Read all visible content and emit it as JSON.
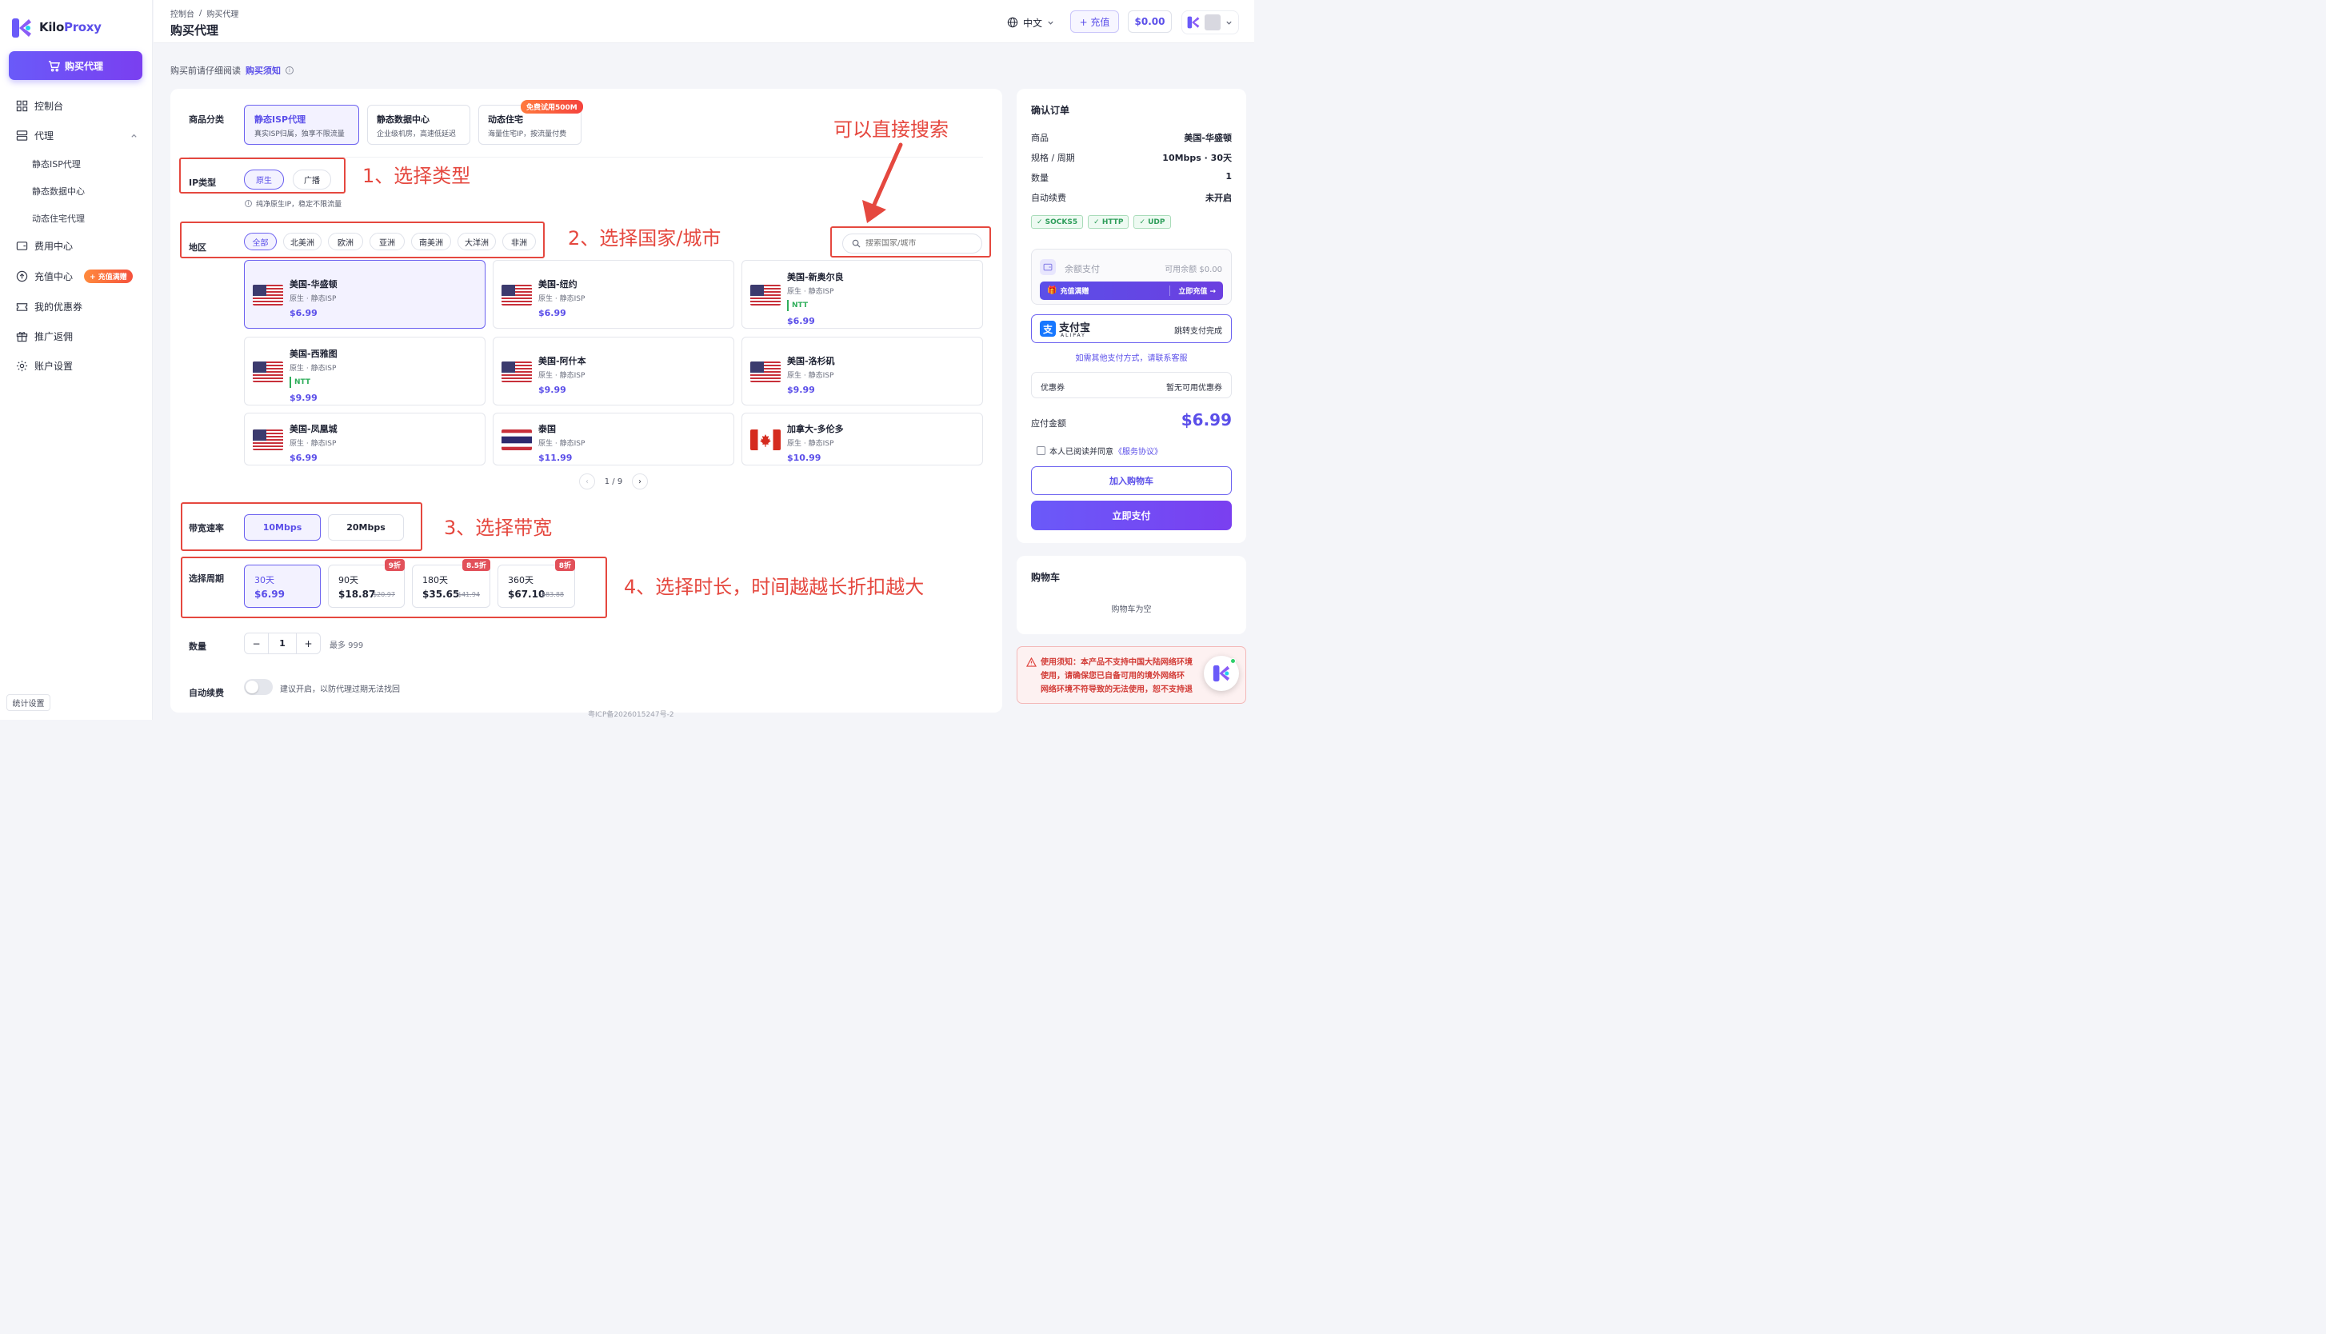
{
  "brand": {
    "name_a": "Kilo",
    "name_b": "Proxy"
  },
  "sidebar": {
    "buy_label": "购买代理",
    "items": [
      {
        "label": "控制台"
      },
      {
        "label": "代理"
      },
      {
        "label": "费用中心"
      },
      {
        "label": "充值中心",
        "badge": "+ 充值满赠"
      },
      {
        "label": "我的优惠券"
      },
      {
        "label": "推广返佣"
      },
      {
        "label": "账户设置"
      }
    ],
    "subitems": [
      {
        "label": "静态ISP代理"
      },
      {
        "label": "静态数据中心"
      },
      {
        "label": "动态住宅代理"
      }
    ],
    "stats_label": "统计设置"
  },
  "header": {
    "breadcrumb_root": "控制台",
    "breadcrumb_sep": "/",
    "breadcrumb_current": "购买代理",
    "title": "购买代理",
    "language": "中文",
    "recharge_label": "+ 充值",
    "balance": "$0.00"
  },
  "notice": {
    "text": "购买前请仔细阅读",
    "link": "购买须知"
  },
  "product": {
    "label": "商品分类",
    "options": [
      {
        "title": "静态ISP代理",
        "desc": "真实ISP归属，独享不限流量"
      },
      {
        "title": "静态数据中心",
        "desc": "企业级机房，高速低延迟"
      },
      {
        "title": "动态住宅",
        "desc": "海量住宅IP，按流量付费",
        "badge": "免费试用500M"
      }
    ]
  },
  "ip_type": {
    "label": "IP类型",
    "options": [
      "原生",
      "广播"
    ],
    "hint": "纯净原生IP，稳定不限流量"
  },
  "region": {
    "label": "地区",
    "filters": [
      "全部",
      "北美洲",
      "欧洲",
      "亚洲",
      "南美洲",
      "大洋洲",
      "非洲"
    ],
    "search_placeholder": "搜索国家/城市",
    "cards": [
      {
        "name": "美国-华盛顿",
        "sub": "原生 · 静态ISP",
        "price": "$6.99",
        "flag": "us"
      },
      {
        "name": "美国-纽约",
        "sub": "原生 · 静态ISP",
        "price": "$6.99",
        "flag": "us"
      },
      {
        "name": "美国-新奥尔良",
        "sub": "原生 · 静态ISP",
        "tag": "NTT",
        "price": "$6.99",
        "flag": "us"
      },
      {
        "name": "美国-西雅图",
        "sub": "原生 · 静态ISP",
        "tag": "NTT",
        "price": "$9.99",
        "flag": "us"
      },
      {
        "name": "美国-阿什本",
        "sub": "原生 · 静态ISP",
        "price": "$9.99",
        "flag": "us"
      },
      {
        "name": "美国-洛杉矶",
        "sub": "原生 · 静态ISP",
        "price": "$9.99",
        "flag": "us"
      },
      {
        "name": "美国-凤凰城",
        "sub": "原生 · 静态ISP",
        "price": "$6.99",
        "flag": "us"
      },
      {
        "name": "泰国",
        "sub": "原生 · 静态ISP",
        "price": "$11.99",
        "flag": "th"
      },
      {
        "name": "加拿大-多伦多",
        "sub": "原生 · 静态ISP",
        "price": "$10.99",
        "flag": "ca"
      }
    ],
    "page": "1 / 9"
  },
  "bandwidth": {
    "label": "带宽速率",
    "options": [
      "10Mbps",
      "20Mbps"
    ]
  },
  "period": {
    "label": "选择周期",
    "options": [
      {
        "name": "30天",
        "price": "$6.99"
      },
      {
        "name": "90天",
        "price": "$18.87",
        "orig": "$20.97",
        "discount": "9折"
      },
      {
        "name": "180天",
        "price": "$35.65",
        "orig": "$41.94",
        "discount": "8.5折"
      },
      {
        "name": "360天",
        "price": "$67.10",
        "orig": "$83.88",
        "discount": "8折"
      }
    ]
  },
  "quantity": {
    "label": "数量",
    "minus": "−",
    "value": "1",
    "plus": "+",
    "max": "最多 999"
  },
  "autorenew": {
    "label": "自动续费",
    "hint": "建议开启，以防代理过期无法找回"
  },
  "icp": "粤ICP备2026015247号-2",
  "annotations": {
    "step1": "1、选择类型",
    "step2": "2、选择国家/城市",
    "step3": "3、选择带宽",
    "step4": "4、选择时长，时间越越长折扣越大",
    "search_hint": "可以直接搜索"
  },
  "order": {
    "title": "确认订单",
    "rows": [
      {
        "k": "商品",
        "v": "美国-华盛顿"
      },
      {
        "k": "规格 / 周期",
        "v": "10Mbps · 30天"
      },
      {
        "k": "数量",
        "v": "1"
      },
      {
        "k": "自动续费",
        "v": "未开启"
      }
    ],
    "protocols": [
      "✓ SOCKS5",
      "✓ HTTP",
      "✓ UDP"
    ],
    "balance_pay": {
      "label": "余额支付",
      "available": "可用余额 $0.00",
      "promo": "充值满赠",
      "promo_action": "立即充值 →"
    },
    "alipay": {
      "name": "支付宝",
      "sub": "ALIPAY",
      "hint": "跳转支付完成"
    },
    "other_pay": "如需其他支付方式，请联系客服",
    "coupon": {
      "label": "优惠券",
      "value": "暂无可用优惠券"
    },
    "total_label": "应付金额",
    "total": "$6.99",
    "agree_text": "本人已阅读并同意",
    "agree_link": "《服务协议》",
    "cart_btn": "加入购物车",
    "pay_btn": "立即支付"
  },
  "cart": {
    "title": "购物车",
    "empty": "购物车为空"
  },
  "warning": {
    "line1": "使用须知：本产品不支持中国大陆网络环境",
    "line2": "使用，请确保您已自备可用的境外网络环",
    "line3": "网络环境不符导致的无法使用，恕不支持退"
  },
  "colors": {
    "accent": "#5b4fe9",
    "annotation": "#e5483f",
    "tag_green": "#2fae5b",
    "discount": "#e2515a"
  }
}
